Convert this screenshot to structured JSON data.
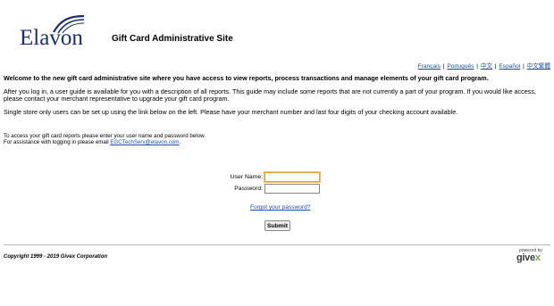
{
  "header": {
    "logo_text": "Elavon",
    "site_title": "Gift Card Administrative Site"
  },
  "languages": [
    "Français",
    "Português",
    "中文",
    "Español",
    "中文繁體"
  ],
  "content": {
    "welcome": "Welcome to the new gift card administrative site where you have access to view reports, process transactions and manage elements of your gift card program.",
    "para1": "After you log in, a user guide is available for you with a description of all reports. This guide may include some reports that are not currently a part of your program. If you would like access, please contact your merchant representative to upgrade your gift card program.",
    "para2": "Single store only users can be set up using the link below on the left. Please have your merchant number and last four digits of your checking account available."
  },
  "access": {
    "line1": "To access your gift card reports please enter your user name and password below.",
    "line2_prefix": "For assistance with logging in please email ",
    "email": "EGCTechServ@elavon.com",
    "line2_suffix": "."
  },
  "login": {
    "username_label": "User Name:",
    "username_value": "",
    "password_label": "Password:",
    "password_value": "",
    "forgot_link": "Forgot your password?",
    "submit_label": "Submit"
  },
  "footer": {
    "copyright": "Copyright 1999 - 2019 Givex Corporation",
    "powered_by": "powered by",
    "givex_main": "give",
    "givex_x": "x"
  },
  "colors": {
    "link": "#1d4ea8",
    "logo": "#1a2f6b",
    "givex_accent": "#6aa84f"
  }
}
